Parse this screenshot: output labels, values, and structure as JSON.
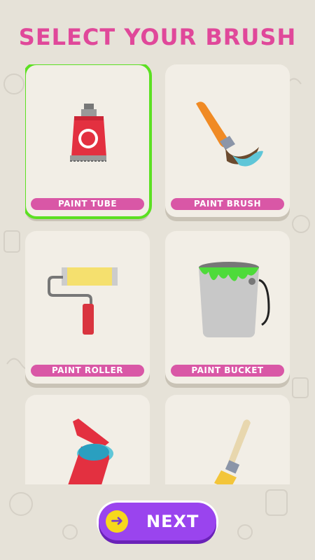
{
  "screen": {
    "title": "SELECT YOUR BRUSH"
  },
  "brushes": [
    {
      "label": "PAINT TUBE",
      "selected": true,
      "icon": "paint-tube-icon"
    },
    {
      "label": "PAINT BRUSH",
      "selected": false,
      "icon": "paint-brush-icon"
    },
    {
      "label": "PAINT ROLLER",
      "selected": false,
      "icon": "paint-roller-icon"
    },
    {
      "label": "PAINT BUCKET",
      "selected": false,
      "icon": "paint-bucket-icon"
    },
    {
      "label": "",
      "selected": false,
      "icon": "spray-can-icon"
    },
    {
      "label": "",
      "selected": false,
      "icon": "flat-brush-icon"
    }
  ],
  "next_button": {
    "label": "NEXT",
    "icon": "arrow-right-icon"
  },
  "colors": {
    "title": "#e0489a",
    "label_bg": "#d957a6",
    "selected_outline": "#5ce022",
    "next_bg": "#9a44ee"
  }
}
